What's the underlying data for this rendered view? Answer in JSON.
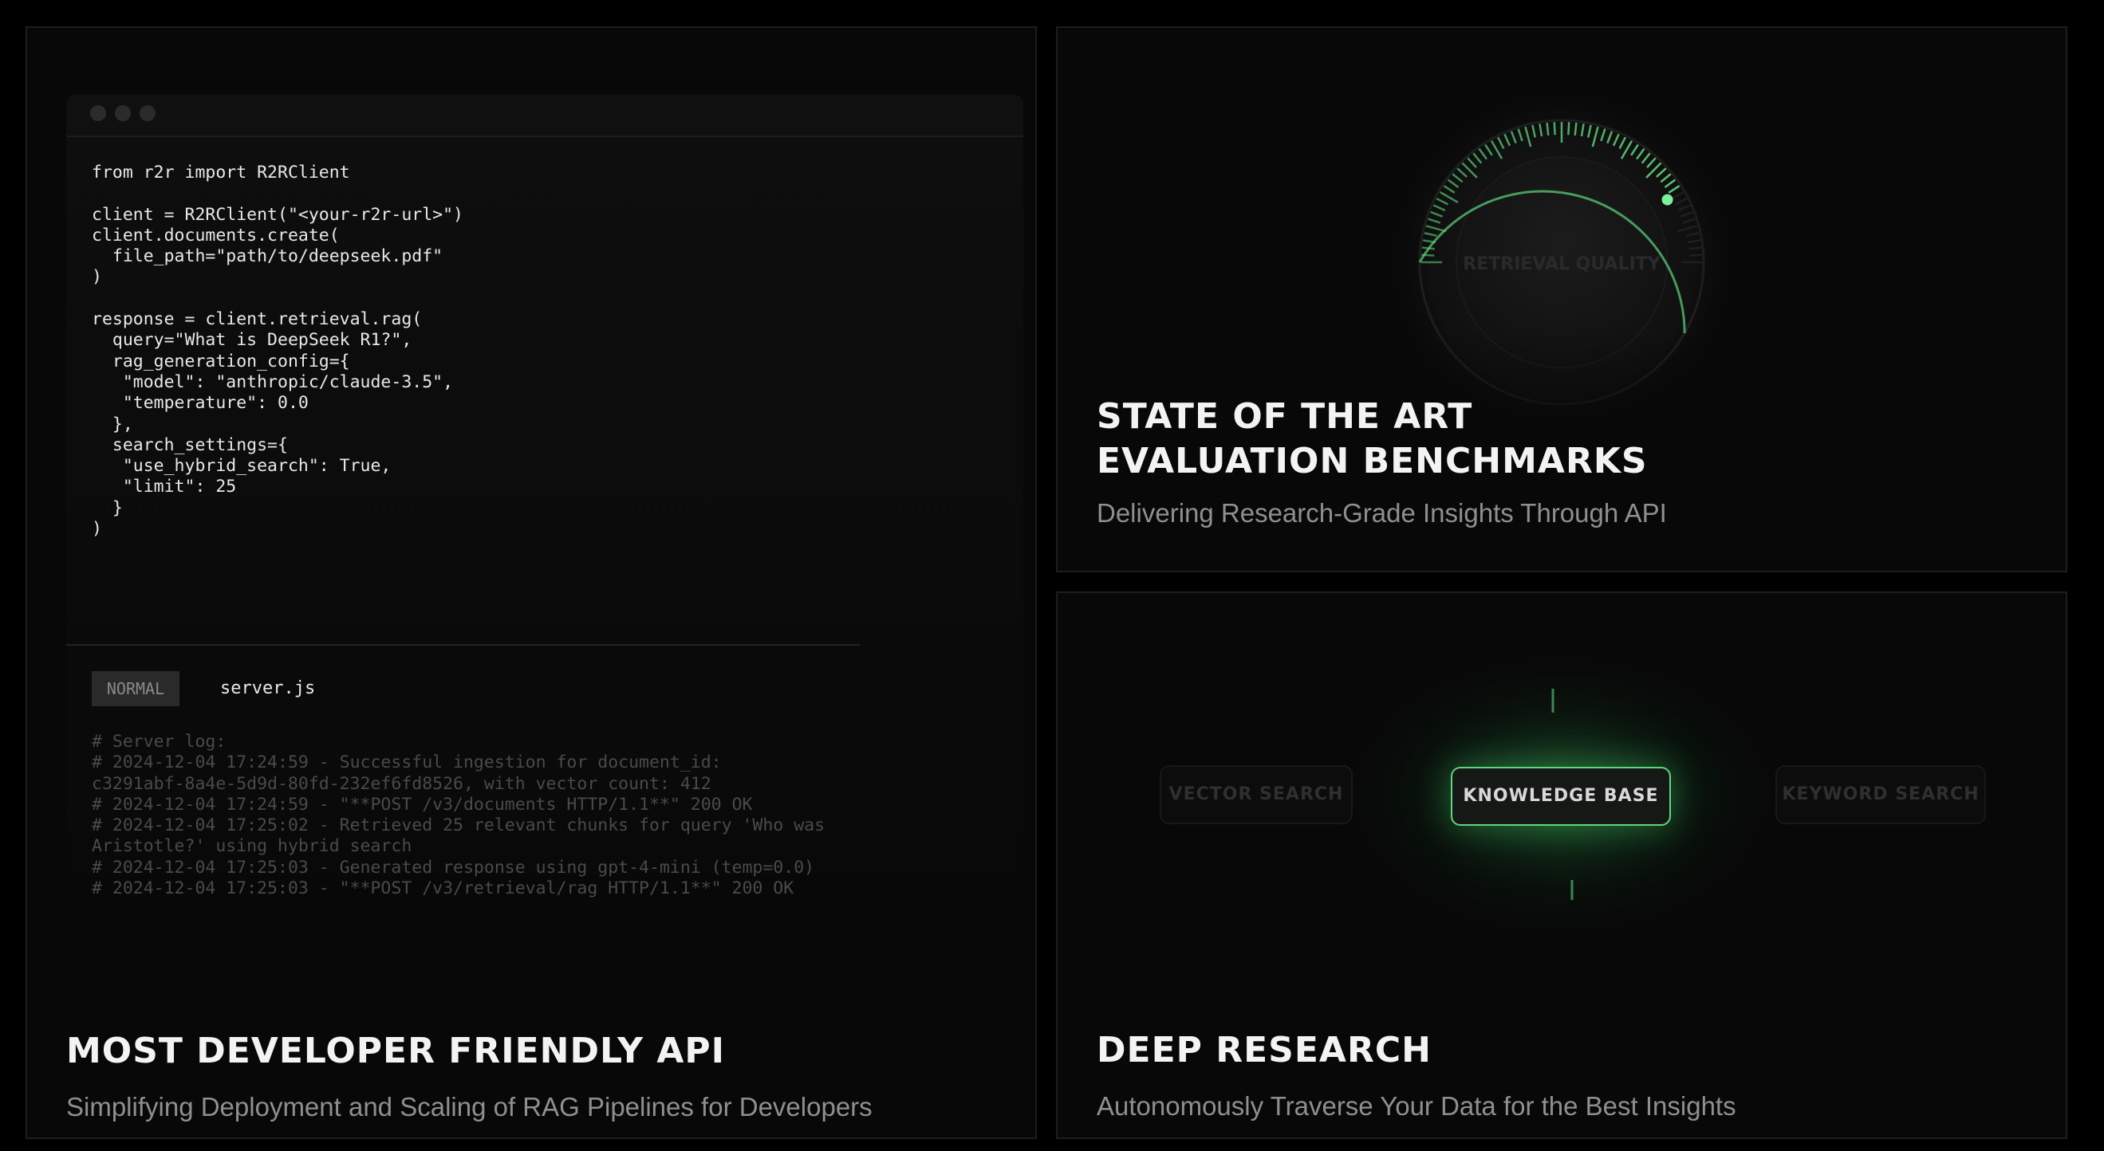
{
  "api_card": {
    "title": "MOST DEVELOPER FRIENDLY API",
    "subtitle": "Simplifying Deployment and Scaling of RAG Pipelines for Developers",
    "code": "from r2r import R2RClient\n\nclient = R2RClient(\"<your-r2r-url>\")\nclient.documents.create(\n  file_path=\"path/to/deepseek.pdf\"\n)\n\nresponse = client.retrieval.rag(\n  query=\"What is DeepSeek R1?\",\n  rag_generation_config={\n   \"model\": \"anthropic/claude-3.5\",\n   \"temperature\": 0.0\n  },\n  search_settings={\n   \"use_hybrid_search\": True,\n   \"limit\": 25\n  }\n)",
    "mode_badge": "NORMAL",
    "file_name": "server.js",
    "log": "# Server log:\n# 2024-12-04 17:24:59 - Successful ingestion for document_id:\nc3291abf-8a4e-5d9d-80fd-232ef6fd8526, with vector count: 412\n# 2024-12-04 17:24:59 - \"**POST /v3/documents HTTP/1.1**\" 200 OK\n# 2024-12-04 17:25:02 - Retrieved 25 relevant chunks for query 'Who was\nAristotle?' using hybrid search\n# 2024-12-04 17:25:03 - Generated response using gpt-4-mini (temp=0.0)\n# 2024-12-04 17:25:03 - \"**POST /v3/retrieval/rag HTTP/1.1**\" 200 OK"
  },
  "eval_card": {
    "title_line1": "STATE OF THE ART",
    "title_line2": "EVALUATION BENCHMARKS",
    "subtitle": "Delivering Research-Grade Insights Through API",
    "gauge_label": "RETRIEVAL QUALITY",
    "gauge_level": 0.83
  },
  "research_card": {
    "title": "DEEP RESEARCH",
    "subtitle": "Autonomously Traverse Your Data for the Best Insights",
    "node_left": "VECTOR SEARCH",
    "node_center": "KNOWLEDGE BASE",
    "node_right": "KEYWORD SEARCH"
  },
  "colors": {
    "accent_green": "#5fd67e",
    "background": "#000000",
    "card_background": "#080808"
  }
}
